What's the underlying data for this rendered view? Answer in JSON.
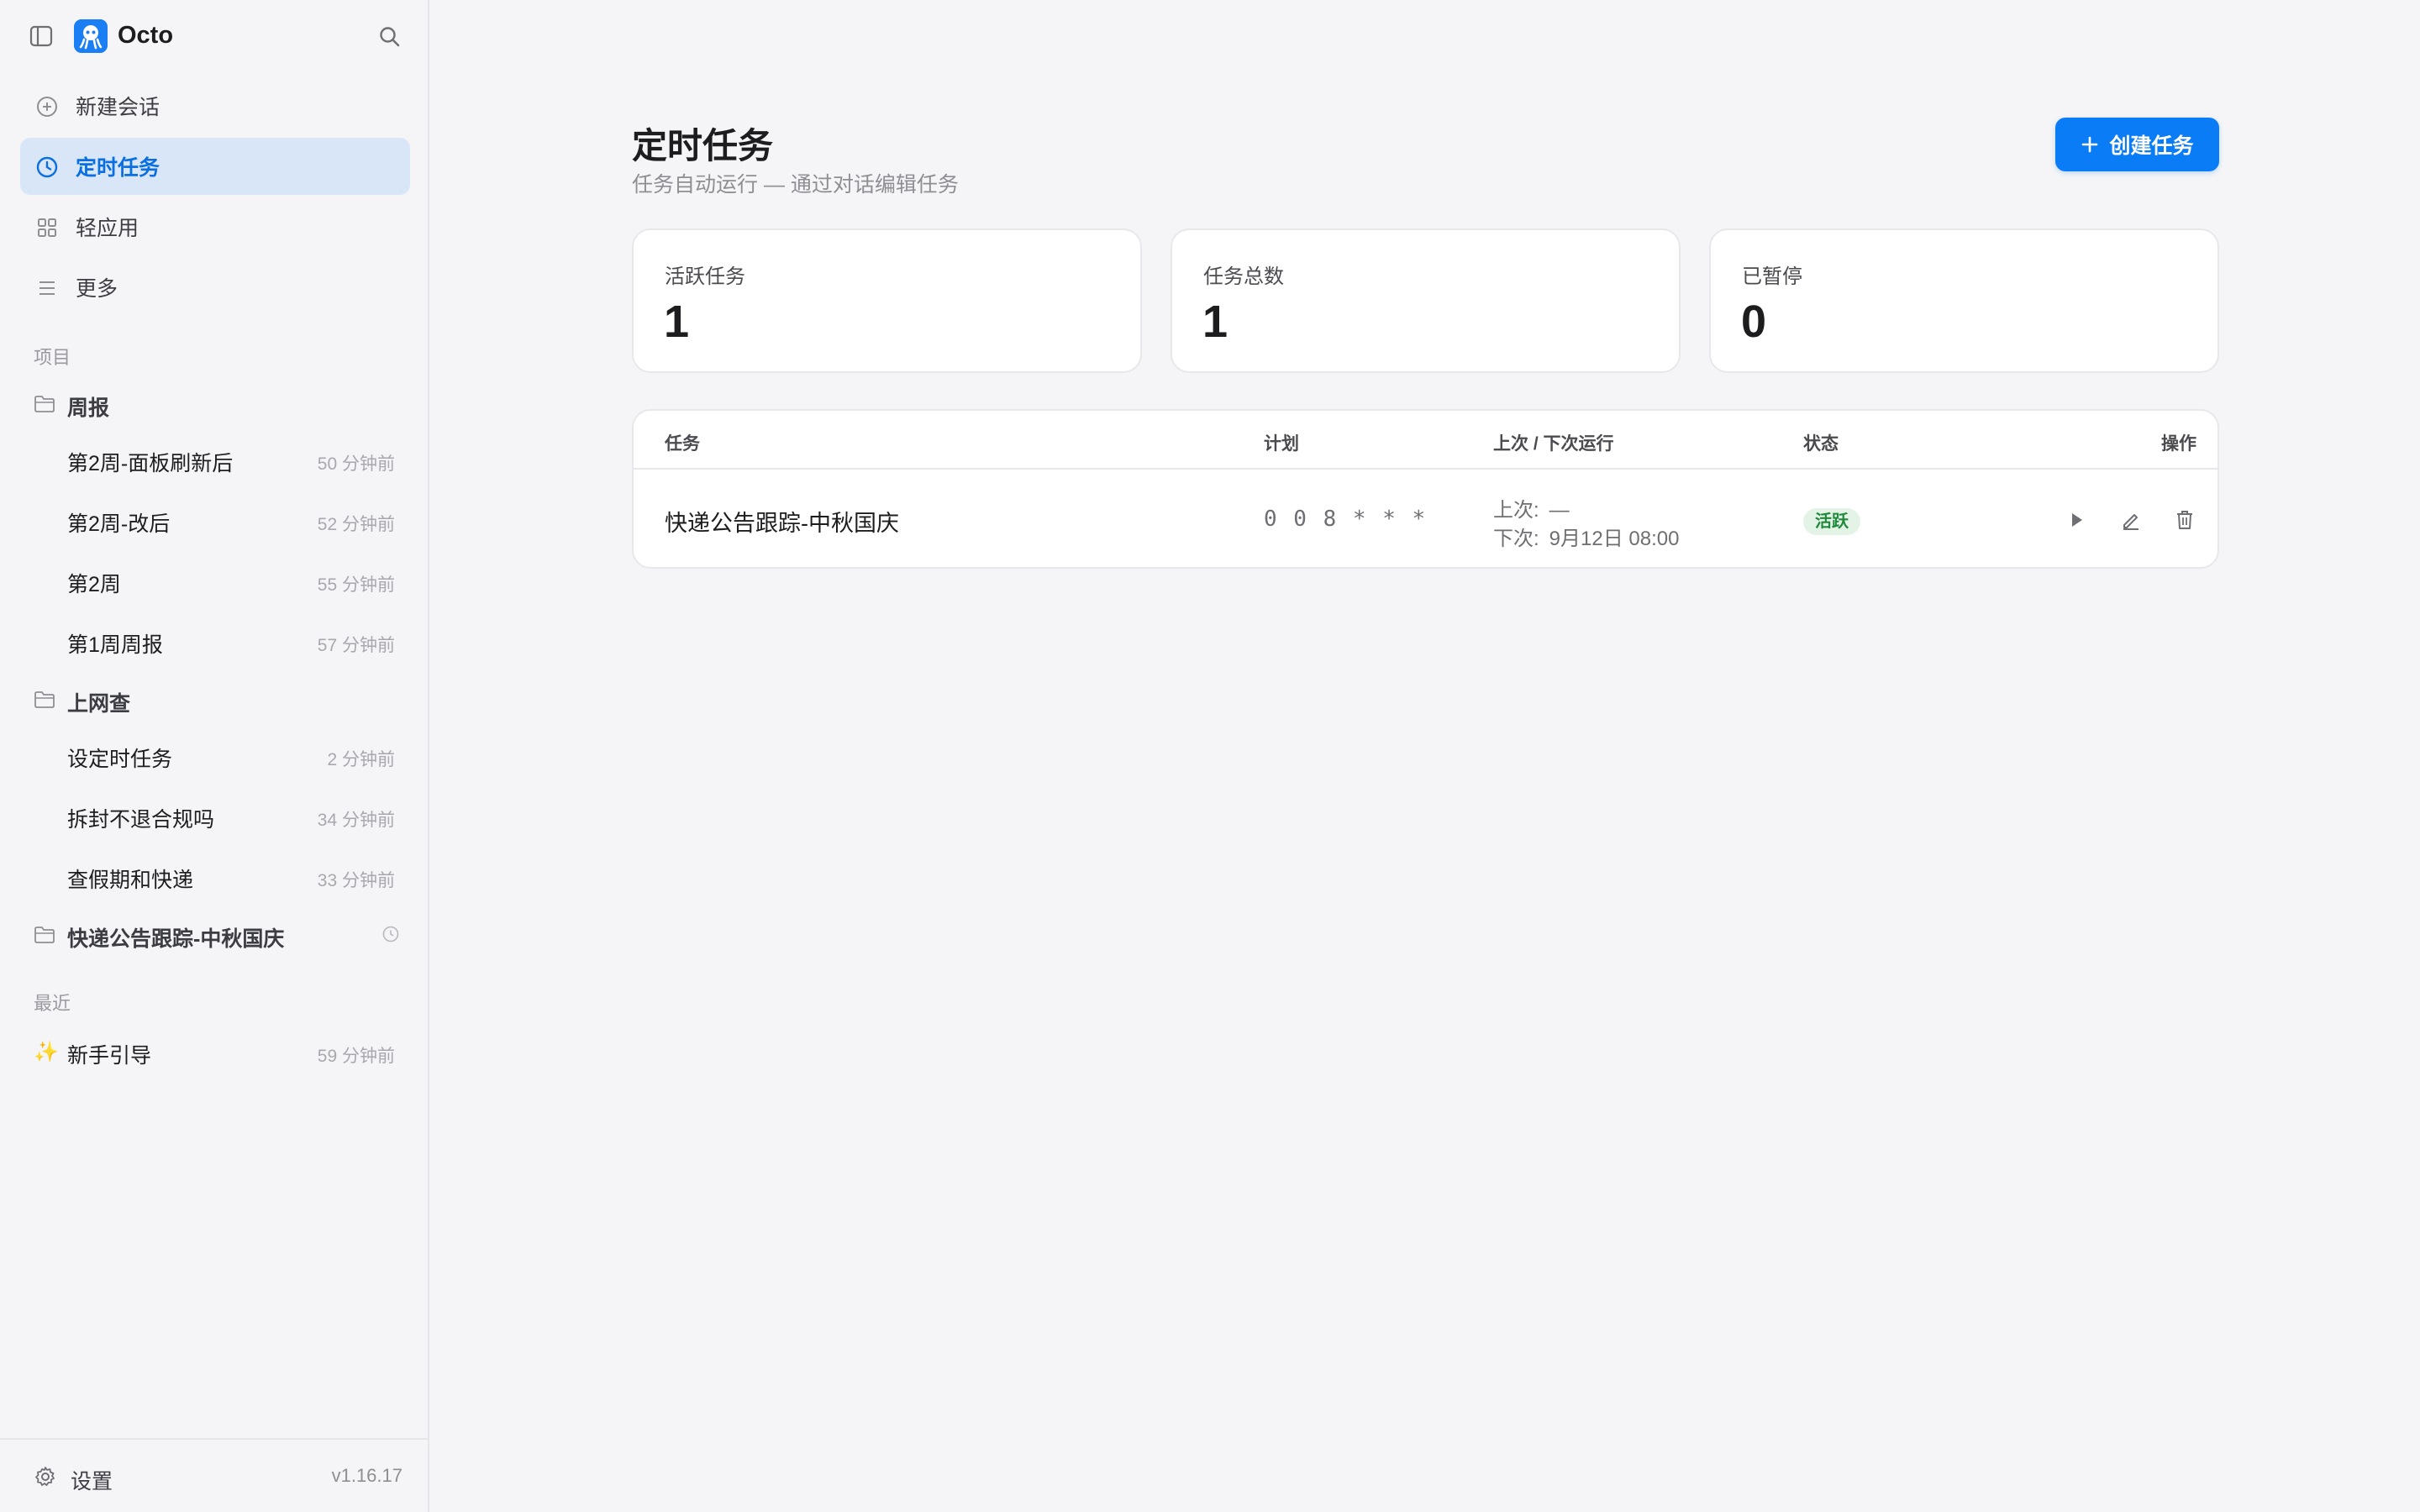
{
  "app": {
    "name": "Octo",
    "version": "v1.16.17"
  },
  "nav": {
    "new_chat": "新建会话",
    "scheduled": "定时任务",
    "light_apps": "轻应用",
    "more": "更多"
  },
  "sections": {
    "projects": "项目",
    "recent": "最近"
  },
  "projects": [
    {
      "name": "周报",
      "items": [
        {
          "title": "第2周-面板刷新后",
          "time": "50 分钟前"
        },
        {
          "title": "第2周-改后",
          "time": "52 分钟前"
        },
        {
          "title": "第2周",
          "time": "55 分钟前"
        },
        {
          "title": "第1周周报",
          "time": "57 分钟前"
        }
      ]
    },
    {
      "name": "上网查",
      "items": [
        {
          "title": "设定时任务",
          "time": "2 分钟前"
        },
        {
          "title": "拆封不退合规吗",
          "time": "34 分钟前"
        },
        {
          "title": "查假期和快递",
          "time": "33 分钟前"
        }
      ]
    },
    {
      "name": "快递公告跟踪-中秋国庆",
      "items": []
    }
  ],
  "recent": [
    {
      "title": "新手引导",
      "time": "59 分钟前",
      "icon": "sparkle-icon"
    }
  ],
  "footer": {
    "settings": "设置"
  },
  "page": {
    "title": "定时任务",
    "subtitle": "任务自动运行 — 通过对话编辑任务",
    "create_label": "创建任务"
  },
  "stats": [
    {
      "label": "活跃任务",
      "value": "1"
    },
    {
      "label": "任务总数",
      "value": "1"
    },
    {
      "label": "已暂停",
      "value": "0"
    }
  ],
  "table": {
    "headers": {
      "task": "任务",
      "schedule": "计划",
      "runs": "上次 / 下次运行",
      "status": "状态",
      "actions": "操作"
    },
    "rows": [
      {
        "name": "快递公告跟踪-中秋国庆",
        "cron": "0 0 8 * * *",
        "last_label": "上次:",
        "last_value": "—",
        "next_label": "下次:",
        "next_value": "9月12日 08:00",
        "status": "活跃"
      }
    ]
  },
  "colors": {
    "accent": "#0a7cf5",
    "active_nav_bg": "#d9e6f8",
    "status_green": "#1f8a3b",
    "status_green_bg": "#e3f4e6"
  }
}
